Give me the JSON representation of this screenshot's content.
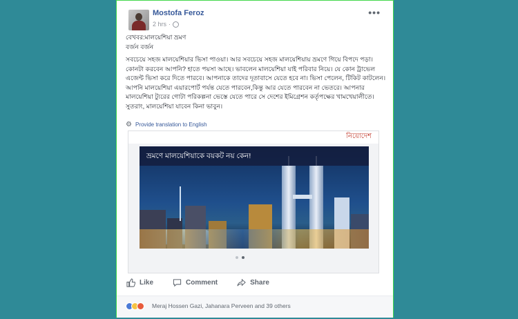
{
  "post": {
    "author": "Mostofa Feroz",
    "time": "2 hrs",
    "more_label": "•••",
    "headline": "বেখবর:মালয়েশিয়া ভ্রমণ",
    "byline": "বর্জন বর্জন",
    "body": "সবচেয়ে সহজ মালয়েশিয়ার ভিসা পাওয়া। আর সবচেয়ে সহজ মালয়েশিয়ায় ভ্রমণে গিয়ে বিপদে পড়া। কোনটা করবেন আপনি? হাতে পয়সা আছে। ভাবলেন মালয়েশিয়া যাই পরিবার নিয়ে। যে কোন ট্রাভেল এজেন্ট ভিসা করে দিতে পারবে। আপনাকে তাদের দূতাবাসে যেতে হবে না। ভিসা পেলেন, টিকিট কাটলেন। আপনি মালয়েশিয়া এয়ারপোর্ট পর্যন্ত যেতে পারবেন,কিন্তু আর যেতে পারবেন না ভেতরে। আপনার মালয়েশিয়া ট্যুরের গোটা পরিকল্পনা ভেস্তে যেতে পারে সে দেশের ইমিগ্রেশন কর্তৃপক্ষের খামখেয়ালীতে। সুতরাং, মালয়েশিয়া যাবেন কিনা ভাবুন।",
    "translate_label": "Provide translation to English"
  },
  "link_card": {
    "brand": "নিয়োদেশ",
    "title": "ভ্রমণে মালয়েশিয়াকে বয়কট নয় কেন!"
  },
  "actions": {
    "like": "Like",
    "comment": "Comment",
    "share": "Share"
  },
  "reactions": {
    "names": "Meraj Hossen Gazi, Jahanara Perveen and 39 others"
  },
  "colors": {
    "background": "#2f8a97",
    "link": "#365899",
    "border": "#42d84a"
  }
}
